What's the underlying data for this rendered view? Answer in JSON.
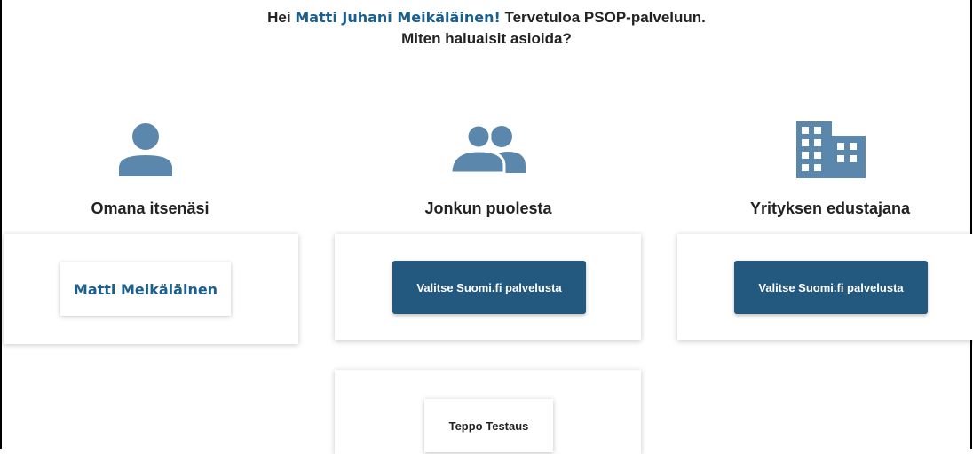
{
  "greeting": {
    "prefix": "Hei",
    "user_name": "Matti Juhani Meikäläinen!",
    "suffix": "Tervetuloa PSOP-palveluun.",
    "question": "Miten haluaisit asioida?"
  },
  "options": {
    "self": {
      "icon": "person-icon",
      "title": "Omana itsenäsi",
      "person_button": "Matti Meikäläinen"
    },
    "on_behalf": {
      "icon": "group-icon",
      "title": "Jonkun puolesta",
      "service_button": "Valitse Suomi.fi palvelusta",
      "person_button": "Teppo Testaus"
    },
    "company": {
      "icon": "building-icon",
      "title": "Yrityksen edustajana",
      "service_button": "Valitse Suomi.fi palvelusta"
    }
  },
  "colors": {
    "accent": "#1a5f8d",
    "button": "#23587f",
    "icon": "#5b87ad"
  }
}
